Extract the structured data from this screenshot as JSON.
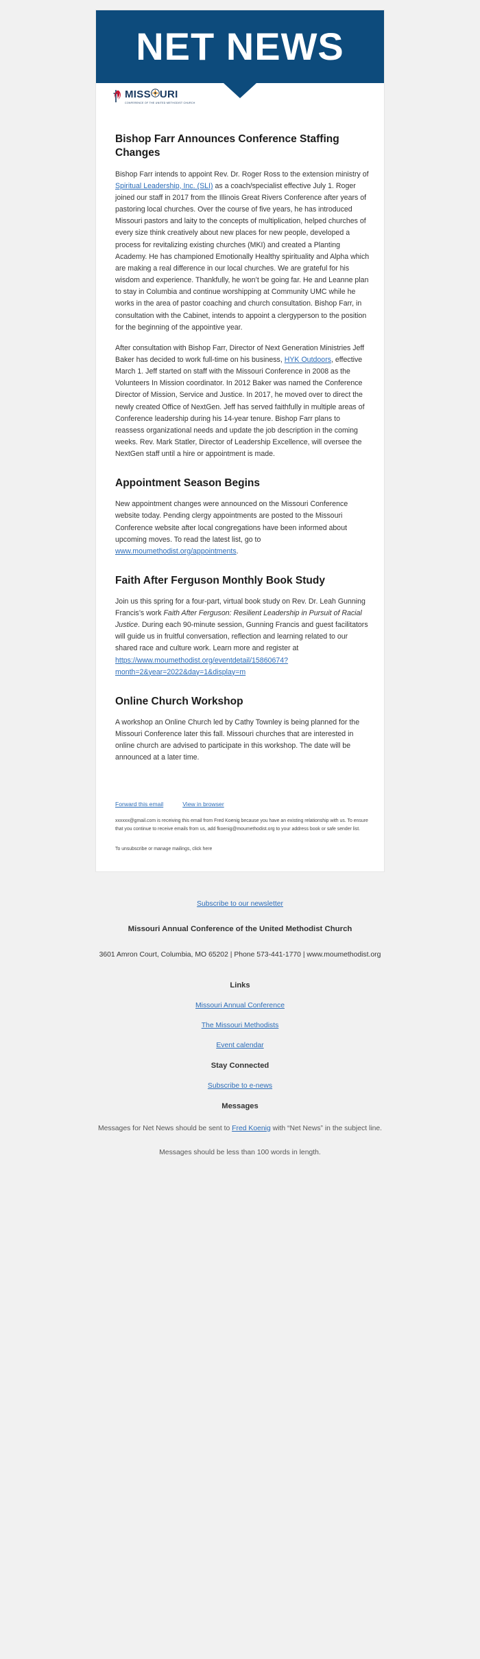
{
  "banner": {
    "title": "NET NEWS",
    "bg_color": "#0d4b7c"
  },
  "logo": {
    "word": "MISS",
    "word_tail": "URI",
    "tagline": "CONFERENCE OF THE UNITED METHODIST CHURCH",
    "flame_color": "#c8102e",
    "text_color": "#17375e"
  },
  "articles": [
    {
      "title": "Bishop Farr Announces Conference Staffing Changes",
      "paragraphs": [
        {
          "pre": "Bishop Farr intends to appoint Rev. Dr. Roger Ross to the extension ministry of ",
          "link": "Spiritual Leadership, Inc. (SLI)",
          "post": " as a coach/specialist effective July 1. Roger joined our staff in 2017 from the Illinois Great Rivers Conference after years of pastoring local churches. Over the course of five years, he has introduced Missouri pastors and laity to the concepts of multiplication, helped churches of every size think creatively about new places for new people, developed a process for revitalizing existing churches (MKI) and created a Planting Academy. He has championed Emotionally Healthy spirituality and Alpha which are making a real difference in our local churches. We are grateful for his wisdom and experience. Thankfully, he won’t be going far. He and Leanne plan to stay in Columbia and continue worshipping at Community UMC while he works in the area of pastor coaching and church consultation. Bishop Farr, in consultation with the Cabinet, intends to appoint a clergyperson to the position for the beginning of the appointive year."
        },
        {
          "pre": "After consultation with Bishop Farr, Director of Next Generation Ministries Jeff Baker has decided to work full-time on his business, ",
          "link": "HYK Outdoors",
          "post": ", effective March 1. Jeff started on staff with the Missouri Conference in 2008 as the Volunteers In Mission coordinator. In 2012 Baker was named the Conference Director of Mission, Service and Justice. In 2017, he moved over to direct the newly created Office of NextGen. Jeff has served faithfully in multiple areas of Conference leadership during his 14-year tenure. Bishop Farr plans to reassess organizational needs and update the job description in the coming weeks. Rev. Mark Statler, Director of Leadership Excellence, will oversee the NextGen staff until a hire or appointment is made."
        }
      ]
    },
    {
      "title": "Appointment Season Begins",
      "paragraphs": [
        {
          "pre": "New appointment changes were announced on the Missouri Conference website today. Pending clergy appointments are posted to the Missouri Conference website after local congregations have been informed about upcoming moves. To read the latest list, go to ",
          "link": "www.moumethodist.org/appointments",
          "post": "."
        }
      ]
    },
    {
      "title": "Faith After Ferguson Monthly Book Study",
      "paragraphs": [
        {
          "pre": "Join us this spring for a four-part, virtual book study on Rev. Dr. Leah Gunning Francis’s work ",
          "italic": "Faith After Ferguson: Resilient Leadership in Pursuit of Racial Justice",
          "mid": ". During each 90-minute session, Gunning Francis and guest facilitators will guide us in fruitful conversation, reflection and learning related to our shared race and culture work. Learn more and register at ",
          "link": "https://www.moumethodist.org/eventdetail/15860674?month=2&year=2022&day=1&display=m",
          "post": ""
        }
      ]
    },
    {
      "title": "Online Church Workshop",
      "paragraphs": [
        {
          "pre": "A workshop an Online Church led by Cathy Townley is being planned for the Missouri Conference later this fall. Missouri churches that are interested in online church are advised to participate in this workshop. The date will be announced at a later time.",
          "link": "",
          "post": ""
        }
      ]
    }
  ],
  "card_footer": {
    "forward_label": "Forward this email",
    "view_browser_label": "View in browser",
    "disclaimer": "xxxxxx@gmail.com is receiving this email from Fred Koenig because you have an existing relationship with us. To ensure that you continue to receive emails from us, add fkoenig@moumethodist.org to your address book or safe sender list.",
    "unsubscribe": "To unsubscribe or manage mailings, click here"
  },
  "outer_footer": {
    "subscribe_label": "Subscribe to our newsletter",
    "org_name": "Missouri Annual Conference of the United Methodist Church",
    "address": "3601 Amron Court, Columbia, MO 65202 | Phone 573-441-1770 | www.moumethodist.org",
    "links_heading": "Links",
    "links": [
      "Missouri Annual Conference",
      "The Missouri Methodists",
      "Event calendar"
    ],
    "stay_connected_heading": "Stay Connected",
    "stay_connected_link": "Subscribe to e-news",
    "messages_heading": "Messages",
    "messages_pre": "Messages for Net News should be sent to ",
    "messages_link": "Fred Koenig",
    "messages_post": " with “Net News” in the subject line.",
    "messages_length": "Messages should be less than 100 words in length."
  },
  "colors": {
    "brand_blue": "#0d4b7c",
    "link_blue": "#2b6cb8",
    "page_bg": "#f1f1f1"
  }
}
